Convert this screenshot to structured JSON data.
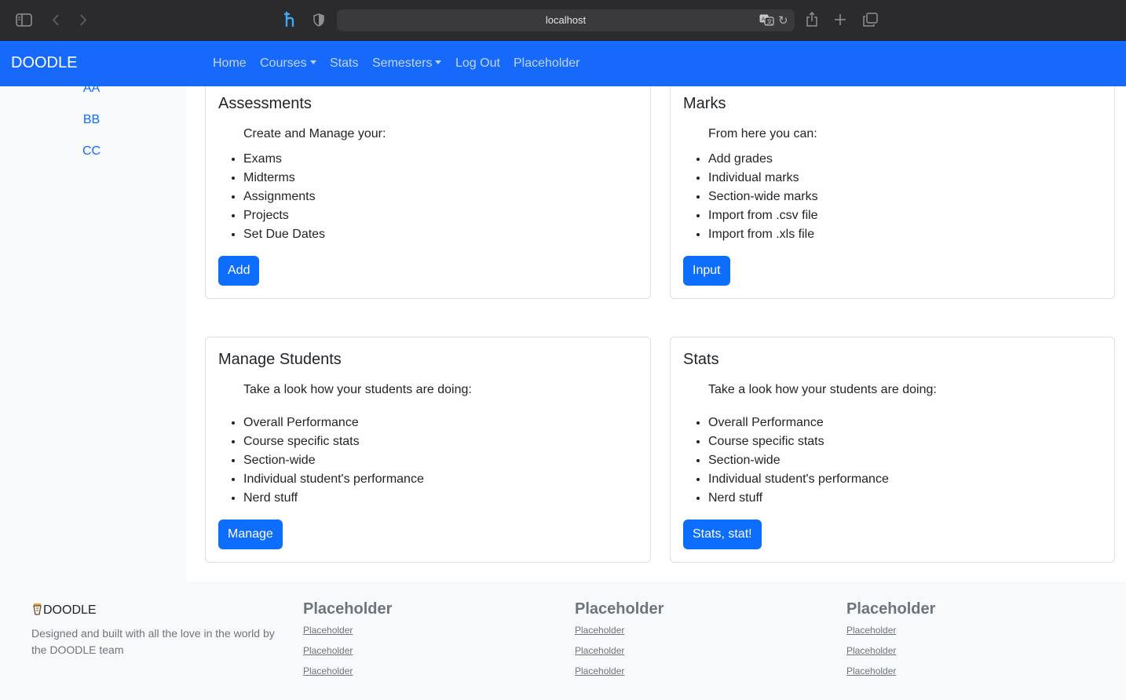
{
  "browser": {
    "url": "localhost"
  },
  "navbar": {
    "brand": "DOODLE",
    "links": [
      "Home",
      "Courses",
      "Stats",
      "Semesters",
      "Log Out",
      "Placeholder"
    ]
  },
  "sidebar": {
    "items": [
      "AA",
      "BB",
      "CC"
    ]
  },
  "cards": [
    {
      "title": "Assessments",
      "intro": "Create and Manage your:",
      "items": [
        "Exams",
        "Midterms",
        "Assignments",
        "Projects",
        "Set Due Dates"
      ],
      "button": "Add"
    },
    {
      "title": "Marks",
      "intro": "From here you can:",
      "items": [
        "Add grades",
        "Individual marks",
        "Section-wide marks",
        "Import from .csv file",
        "Import from .xls file"
      ],
      "button": "Input"
    },
    {
      "title": "Manage Students",
      "intro": "Take a look how your students are doing:",
      "items": [
        "Overall Performance",
        "Course specific stats",
        "Section-wide",
        "Individual student's performance",
        "Nerd stuff"
      ],
      "button": "Manage"
    },
    {
      "title": "Stats",
      "intro": "Take a look how your students are doing:",
      "items": [
        "Overall Performance",
        "Course specific stats",
        "Section-wide",
        "Individual student's performance",
        "Nerd stuff"
      ],
      "button": "Stats, stat!"
    }
  ],
  "footer": {
    "brand": "DOODLE",
    "description": "Designed and built with all the love in the world by the DOODLE team",
    "columns": [
      {
        "heading": "Placeholder",
        "links": [
          "Placeholder",
          "Placeholder",
          "Placeholder"
        ]
      },
      {
        "heading": "Placeholder",
        "links": [
          "Placeholder",
          "Placeholder",
          "Placeholder"
        ]
      },
      {
        "heading": "Placeholder",
        "links": [
          "Placeholder",
          "Placeholder",
          "Placeholder"
        ]
      }
    ]
  },
  "colors": {
    "primary": "#0d6efd",
    "navbar": "#1669fb",
    "chrome": "#2b2b2d",
    "muted": "#6c757d",
    "light_bg": "#f8f9fa"
  }
}
